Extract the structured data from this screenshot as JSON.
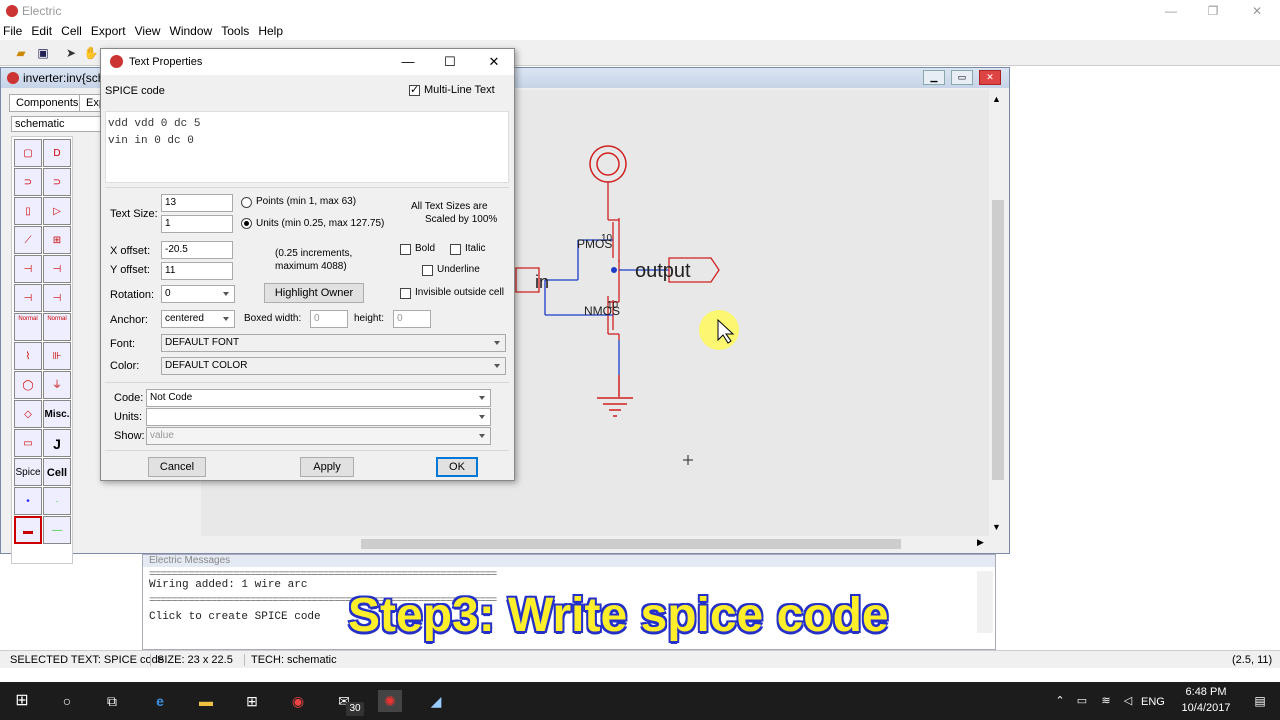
{
  "app": {
    "title": "Electric",
    "min": "—",
    "max": "❐",
    "close": "✕"
  },
  "menu": [
    "File",
    "Edit",
    "Cell",
    "Export",
    "View",
    "Window",
    "Tools",
    "Help"
  ],
  "schematic_window": {
    "title": "inverter:inv{sch",
    "tabs": [
      "Components",
      "Expl"
    ],
    "view_select": "schematic"
  },
  "palette_labels": {
    "misc": "Misc.",
    "j": "J",
    "spice": "Spice",
    "cell": "Cell",
    "normal1": "Normal",
    "normal2": "Normal"
  },
  "schematic": {
    "pmos_label": "PMOS",
    "pmos_size": "10",
    "nmos_label": "NMOS",
    "nmos_size": "10",
    "in_label": "in",
    "output_label": "output"
  },
  "dialog": {
    "title": "Text Properties",
    "min": "—",
    "max": "☐",
    "close": "✕",
    "subtitle": "SPICE code",
    "multiline_label": "Multi-Line Text",
    "code": "vdd vdd 0 dc 5\nvin in 0 dc 0\n",
    "text_size_label": "Text Size:",
    "text_size_points": "13",
    "text_size_units": "1",
    "points_label": "Points (min 1, max 63)",
    "units_label": "Units (min 0.25, max 127.75)",
    "scaled_note_1": "All Text Sizes are",
    "scaled_note_2": "Scaled by 100%",
    "xoffset_label": "X offset:",
    "xoffset": "-20.5",
    "yoffset_label": "Y offset:",
    "yoffset": "11",
    "increment_note_1": "(0.25 increments,",
    "increment_note_2": "maximum 4088)",
    "bold_label": "Bold",
    "italic_label": "Italic",
    "underline_label": "Underline",
    "rotation_label": "Rotation:",
    "rotation": "0",
    "highlight_owner": "Highlight Owner",
    "invisible_label": "Invisible outside cell",
    "anchor_label": "Anchor:",
    "anchor": "centered",
    "boxed_width_label": "Boxed width:",
    "boxed_width": "0",
    "height_label": "height:",
    "height": "0",
    "font_label": "Font:",
    "font": "DEFAULT FONT",
    "color_label": "Color:",
    "color": "DEFAULT COLOR",
    "code_label": "Code:",
    "code_value": "Not Code",
    "units_field_label": "Units:",
    "units_value": "",
    "show_label": "Show:",
    "show_value": "value",
    "cancel": "Cancel",
    "apply": "Apply",
    "ok": "OK"
  },
  "messages": {
    "title": "Electric Messages",
    "lines": [
      "Wiring added: 1 wire arc",
      "Click to create SPICE code"
    ]
  },
  "overlay_text": "Step3: Write spice code",
  "status": {
    "selected": "SELECTED TEXT: SPICE code",
    "size": "SIZE: 23 x 22.5",
    "tech": "TECH: schematic",
    "coords": "(2.5, 11)"
  },
  "taskbar": {
    "time": "6:48 PM",
    "date": "10/4/2017",
    "lang": "ENG",
    "mail_badge": "30"
  },
  "colors": {
    "schematic_red": "#d02020",
    "wire_blue": "#1a3cc8",
    "accent": "#0078d7"
  }
}
